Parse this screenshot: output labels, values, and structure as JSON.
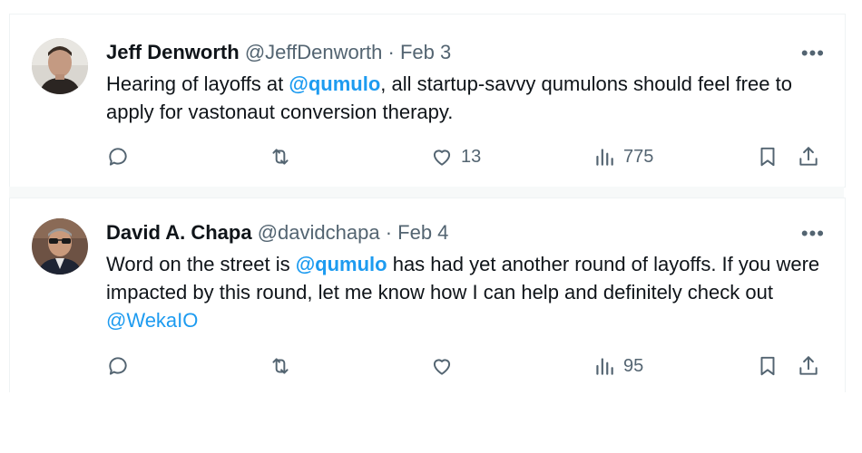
{
  "tweets": [
    {
      "author_name": "Jeff Denworth",
      "author_handle": "@JeffDenworth",
      "separator": "·",
      "date": "Feb 3",
      "more_label": "•••",
      "text_parts": {
        "p1": "Hearing of layoffs at ",
        "m1": "@qumulo",
        "p2": ", all startup-savvy qumulons should feel free to apply for vastonaut conversion therapy."
      },
      "likes": "13",
      "views": "775",
      "icons": [
        "reply-icon",
        "retweet-icon",
        "like-icon",
        "views-icon",
        "bookmark-icon",
        "share-icon"
      ]
    },
    {
      "author_name": "David A. Chapa",
      "author_handle": "@davidchapa",
      "separator": "·",
      "date": "Feb 4",
      "more_label": "•••",
      "text_parts": {
        "p1": "Word on the street is ",
        "m1": "@qumulo",
        "p2": " has had yet another round of layoffs.  If you were impacted by this round, let me know how I can help and definitely check out ",
        "m2": "@WekaIO"
      },
      "views": "95",
      "icons": [
        "reply-icon",
        "retweet-icon",
        "like-icon",
        "views-icon",
        "bookmark-icon",
        "share-icon"
      ]
    }
  ],
  "colors": {
    "link": "#1d9bf0",
    "muted": "#536471",
    "text": "#0f1419"
  }
}
